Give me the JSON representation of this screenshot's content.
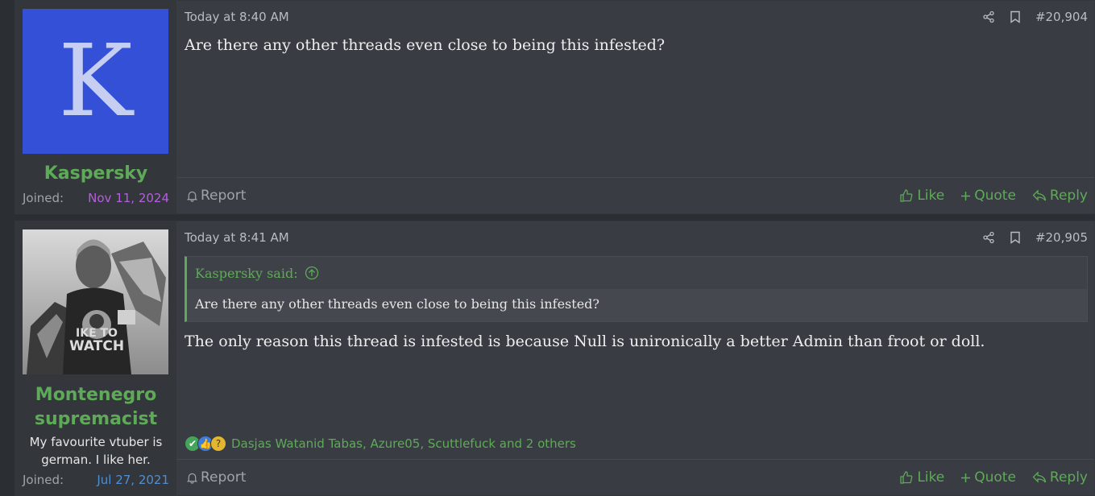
{
  "posts": [
    {
      "user": {
        "avatar_letter": "K",
        "avatar_color": "#3350d6",
        "name": "Kaspersky",
        "joined_label": "Joined:",
        "joined_date": "Nov 11, 2024"
      },
      "timestamp": "Today at 8:40 AM",
      "post_number": "#20,904",
      "content": "Are there any other threads even close to being this infested?",
      "footer": {
        "report": "Report",
        "like": "Like",
        "quote": "Quote",
        "reply": "Reply"
      }
    },
    {
      "user": {
        "avatar_alt": "user avatar image",
        "name": "Montenegro supremacist",
        "title": "My favourite vtuber is german. I like her.",
        "joined_label": "Joined:",
        "joined_date": "Jul 27, 2021"
      },
      "timestamp": "Today at 8:41 AM",
      "post_number": "#20,905",
      "quote": {
        "author": "Kaspersky said:",
        "text": "Are there any other threads even close to being this infested?"
      },
      "content": "The only reason this thread is infested is because Null is unironically a better Admin than froot or doll.",
      "reactions": {
        "icons": [
          "check-icon",
          "thumbs-up-icon",
          "thinking-icon"
        ],
        "text": "Dasjas Watanid Tabas, Azure05, Scuttlefuck and 2 others"
      },
      "footer": {
        "report": "Report",
        "like": "Like",
        "quote": "Quote",
        "reply": "Reply"
      }
    }
  ],
  "colors": {
    "accent_green": "#5eaa58",
    "joined_purple": "#b55ee0",
    "joined_blue": "#4f8fd1"
  }
}
